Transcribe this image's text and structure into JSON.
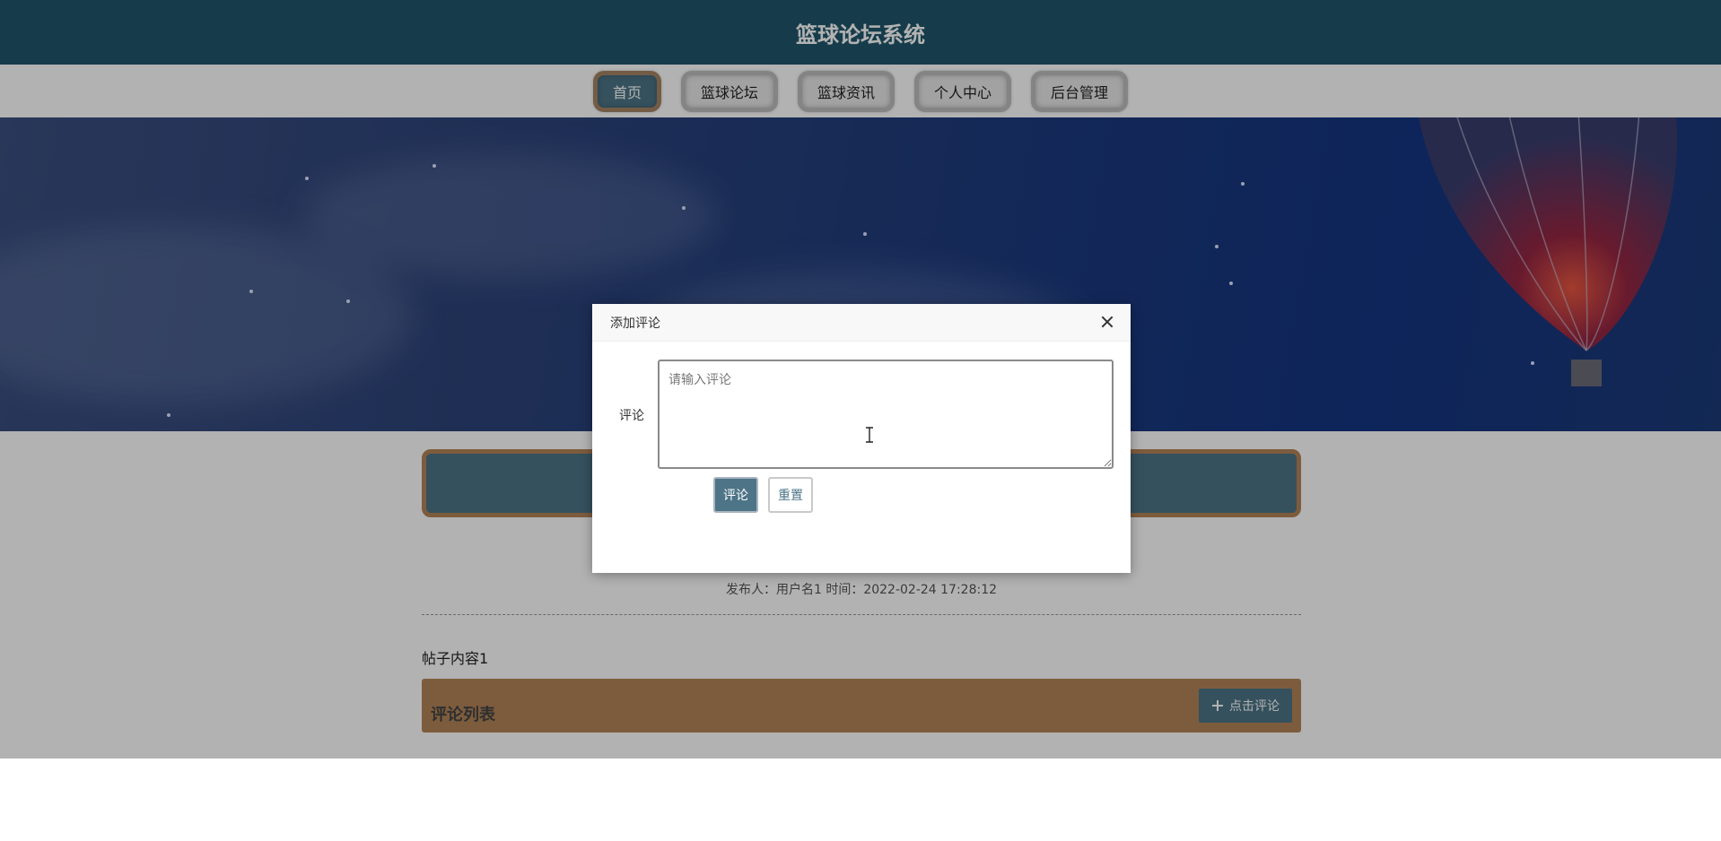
{
  "header": {
    "title": "篮球论坛系统"
  },
  "nav": {
    "items": [
      {
        "label": "首页",
        "active": true
      },
      {
        "label": "篮球论坛",
        "active": false
      },
      {
        "label": "篮球资讯",
        "active": false
      },
      {
        "label": "个人中心",
        "active": false
      },
      {
        "label": "后台管理",
        "active": false
      }
    ]
  },
  "post": {
    "meta": "发布人：用户名1 时间：2022-02-24 17:28:12",
    "content": "帖子内容1"
  },
  "comments": {
    "title": "评论列表",
    "add_button_label": "点击评论"
  },
  "dialog": {
    "title": "添加评论",
    "field_label": "评论",
    "placeholder": "请输入评论",
    "submit_label": "评论",
    "reset_label": "重置"
  },
  "colors": {
    "header_bg": "#20576c",
    "accent": "#4d7487",
    "accent_border": "#b48558"
  }
}
